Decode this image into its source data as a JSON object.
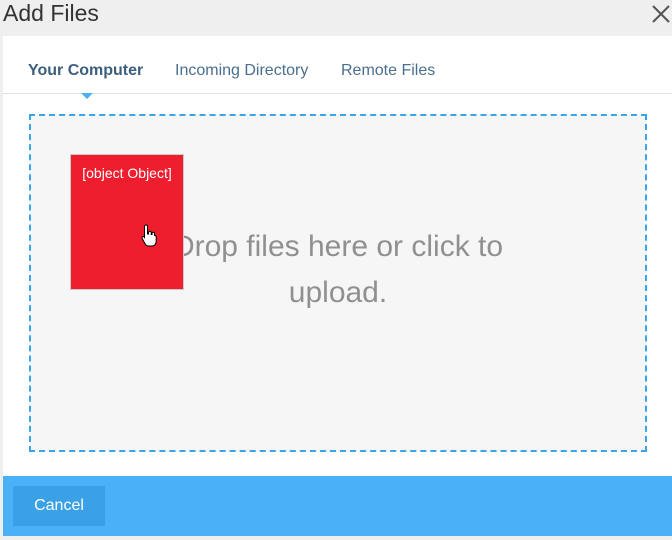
{
  "dialog": {
    "title": "Add Files",
    "close_icon": "close-icon"
  },
  "tabs": [
    {
      "label": "Your Computer",
      "active": true
    },
    {
      "label": "Incoming Directory",
      "active": false
    },
    {
      "label": "Remote Files",
      "active": false
    }
  ],
  "dropzone": {
    "text": "Drop files here or click to upload.",
    "drag_preview_label": "[object Object]",
    "cursor_icon": "hand-pointer-icon"
  },
  "footer": {
    "cancel_label": "Cancel"
  },
  "colors": {
    "accent": "#4ab1f7",
    "dropzone_border": "#3aa5e8",
    "drag_preview": "#ee1e2f"
  }
}
